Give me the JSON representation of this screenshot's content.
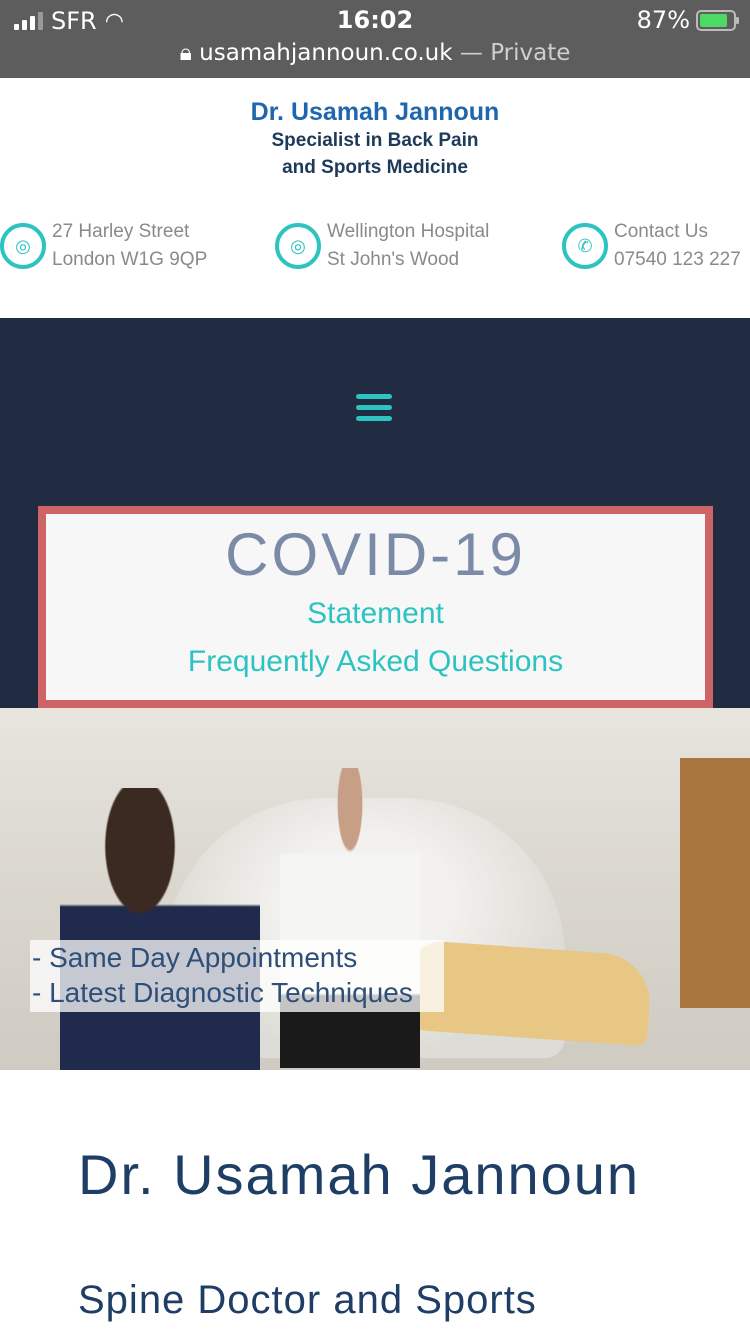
{
  "status": {
    "carrier": "SFR",
    "time": "16:02",
    "battery": "87%",
    "battery_level": 0.87
  },
  "browser": {
    "url": "usamahjannoun.co.uk",
    "mode": " — Private"
  },
  "logo": {
    "name": "Dr. Usamah Jannoun",
    "line1": "Specialist in Back Pain",
    "line2": "and Sports Medicine"
  },
  "contacts": [
    {
      "icon": "map-pin",
      "line1": "27 Harley Street",
      "line2": "London W1G 9QP"
    },
    {
      "icon": "map-pin",
      "line1": "Wellington Hospital",
      "line2": "St John's Wood"
    },
    {
      "icon": "phone",
      "line1": "Contact Us",
      "line2": "07540 123 227"
    }
  ],
  "covid": {
    "title": "COVID-19",
    "link1": "Statement",
    "link2": "Frequently Asked Questions"
  },
  "hero": {
    "line1": "- Same Day Appointments",
    "line2": "- Latest Diagnostic Techniques"
  },
  "main": {
    "title": "Dr. Usamah Jannoun",
    "subtitle": "Spine Doctor and Sports"
  },
  "colors": {
    "accent": "#2cc3c0",
    "nav": "#212b42",
    "covid_border": "#cd6466",
    "heading": "#1e3e66"
  }
}
